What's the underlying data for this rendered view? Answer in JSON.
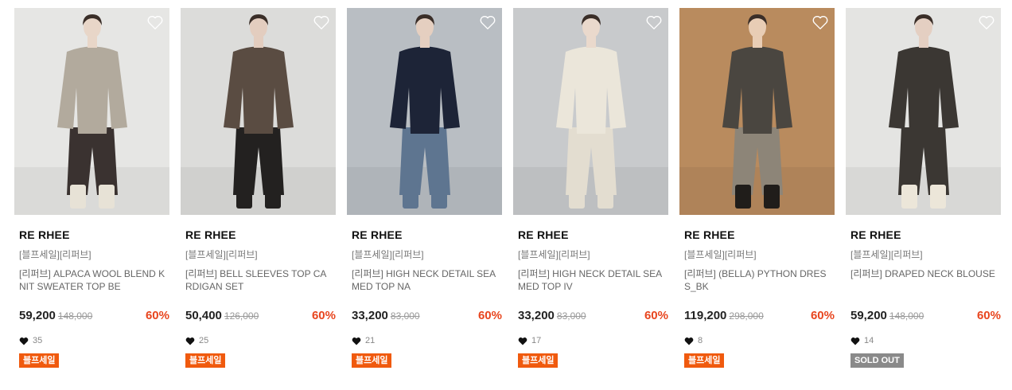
{
  "products": [
    {
      "brand": "RE RHEE",
      "tag": "[블프세일][리퍼브]",
      "name": "[리퍼브] ALPACA WOOL BLEND KNIT SWEATER TOP BE",
      "price": "59,200",
      "original": "148,000",
      "discount": "60%",
      "likes": "35",
      "badge": "블프세일",
      "bg": "#e6e6e4",
      "skin": "#e8d6c8",
      "top": "#b2aa9d",
      "bottom": "#3a3230",
      "shoes": "#e7e2d6"
    },
    {
      "brand": "RE RHEE",
      "tag": "[블프세일][리퍼브]",
      "name": "[리퍼브] BELL SLEEVES TOP CARDIGAN SET",
      "price": "50,400",
      "original": "126,000",
      "discount": "60%",
      "likes": "25",
      "badge": "블프세일",
      "bg": "#dcdcda",
      "skin": "#e3cdbf",
      "top": "#5a4c42",
      "bottom": "#232120",
      "shoes": "#232120"
    },
    {
      "brand": "RE RHEE",
      "tag": "[블프세일][리퍼브]",
      "name": "[리퍼브] HIGH NECK DETAIL SEAMED TOP NA",
      "price": "33,200",
      "original": "83,000",
      "discount": "60%",
      "likes": "21",
      "badge": "블프세일",
      "bg": "#b9bec3",
      "skin": "#e5cfc0",
      "top": "#1d2437",
      "bottom": "#5e7590",
      "shoes": "#5e7590"
    },
    {
      "brand": "RE RHEE",
      "tag": "[블프세일][리퍼브]",
      "name": "[리퍼브] HIGH NECK DETAIL SEAMED TOP IV",
      "price": "33,200",
      "original": "83,000",
      "discount": "60%",
      "likes": "17",
      "badge": "블프세일",
      "bg": "#c8cacc",
      "skin": "#ead9cc",
      "top": "#ebe6da",
      "bottom": "#e3ddd0",
      "shoes": "#e3ddd0"
    },
    {
      "brand": "RE RHEE",
      "tag": "[블프세일][리퍼브]",
      "name": "[리퍼브] (BELLA) PYTHON DRESS_BK",
      "price": "119,200",
      "original": "298,000",
      "discount": "60%",
      "likes": "8",
      "badge": "블프세일",
      "bg": "#b98b5e",
      "skin": "#e8cdb5",
      "top": "#4a4640",
      "bottom": "#8d8578",
      "shoes": "#201d1a"
    },
    {
      "brand": "RE RHEE",
      "tag": "[블프세일][리퍼브]",
      "name": "[리퍼브] DRAPED NECK BLOUSE",
      "price": "59,200",
      "original": "148,000",
      "discount": "60%",
      "likes": "14",
      "badge": "SOLD OUT",
      "sold_out": true,
      "bg": "#e4e4e2",
      "skin": "#e4cfc2",
      "top": "#3b3733",
      "bottom": "#3b3733",
      "shoes": "#ece6d9"
    }
  ],
  "colors": {
    "accent": "#e8451e",
    "badge": "#f05a0e",
    "soldout": "#8a8a8a"
  }
}
